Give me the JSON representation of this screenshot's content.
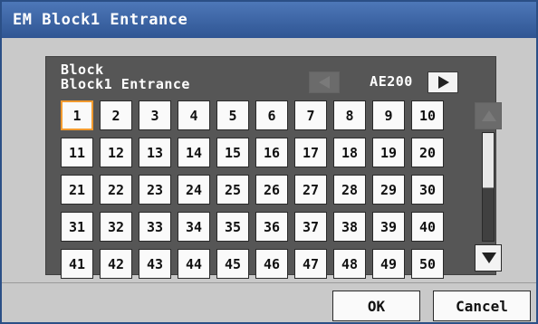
{
  "window": {
    "title": "EM Block1 Entrance"
  },
  "block": {
    "label_line1": "Block",
    "label_line2": "Block1 Entrance"
  },
  "controller": {
    "name": "AE200"
  },
  "units": [
    "1",
    "2",
    "3",
    "4",
    "5",
    "6",
    "7",
    "8",
    "9",
    "10",
    "11",
    "12",
    "13",
    "14",
    "15",
    "16",
    "17",
    "18",
    "19",
    "20",
    "21",
    "22",
    "23",
    "24",
    "25",
    "26",
    "27",
    "28",
    "29",
    "30",
    "31",
    "32",
    "33",
    "34",
    "35",
    "36",
    "37",
    "38",
    "39",
    "40",
    "41",
    "42",
    "43",
    "44",
    "45",
    "46",
    "47",
    "48",
    "49",
    "50"
  ],
  "selected_unit": "1",
  "buttons": {
    "ok": "OK",
    "cancel": "Cancel"
  },
  "icons": {
    "prev": "left-arrow-icon",
    "next": "right-arrow-icon",
    "scroll_up": "up-arrow-icon",
    "scroll_down": "down-arrow-icon"
  },
  "colors": {
    "title_bar": "#3a63a6",
    "selection": "#f29a2e",
    "panel": "#565656"
  }
}
